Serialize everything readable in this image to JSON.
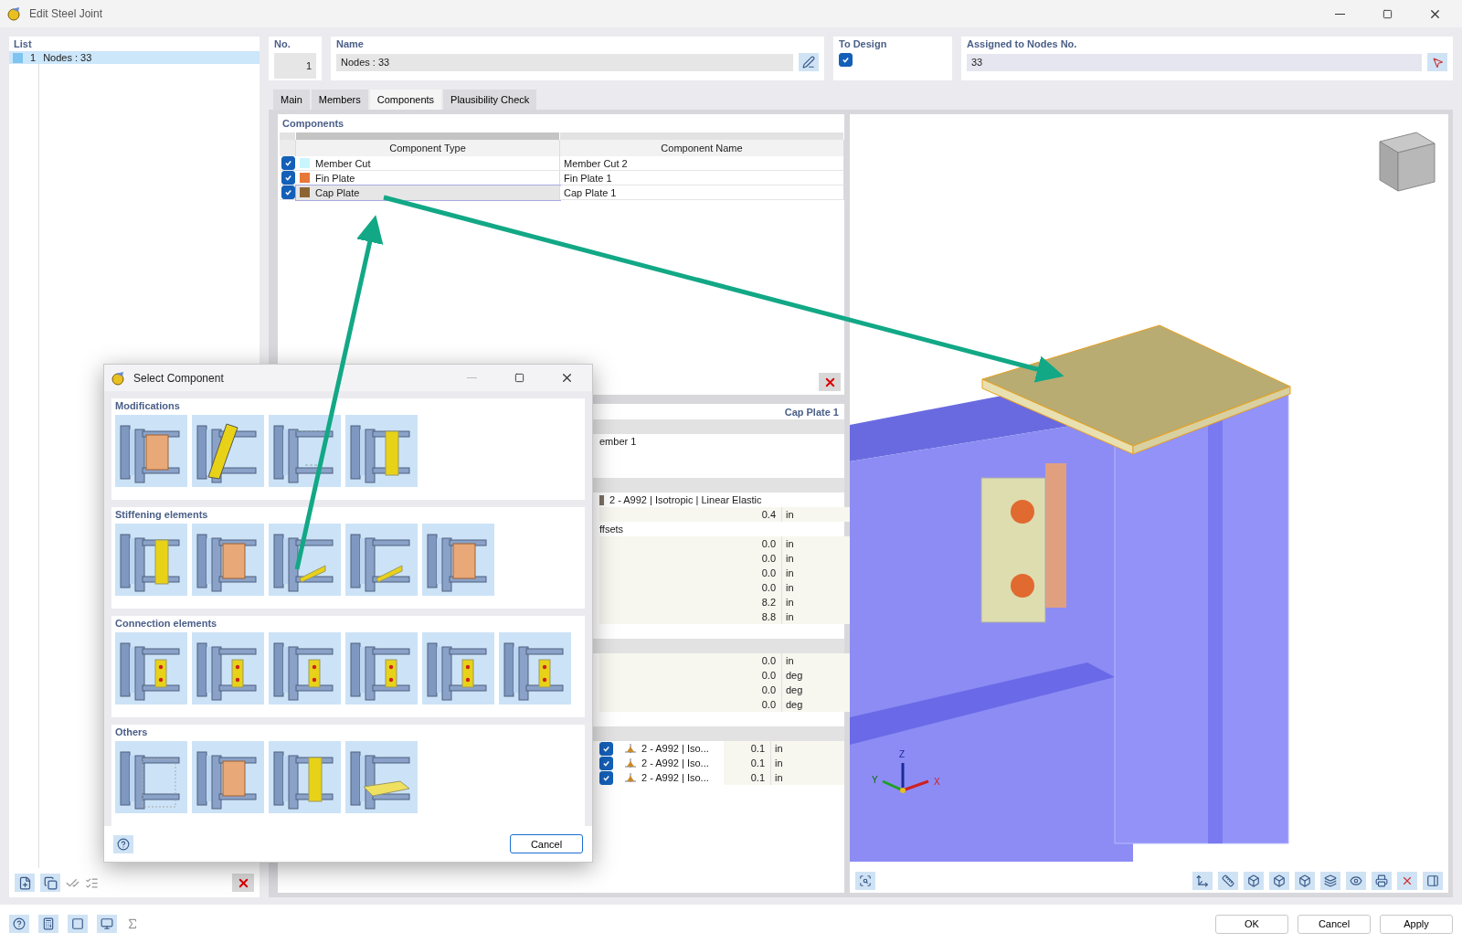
{
  "window": {
    "title": "Edit Steel Joint"
  },
  "list": {
    "title": "List",
    "items": [
      {
        "number": "1",
        "label": "Nodes : 33",
        "selected": true
      }
    ]
  },
  "header_fields": {
    "no": {
      "label": "No.",
      "value": "1"
    },
    "name": {
      "label": "Name",
      "value": "Nodes : 33"
    },
    "to_design": {
      "label": "To Design",
      "checked": true
    },
    "assigned_nodes": {
      "label": "Assigned to Nodes No.",
      "value": "33"
    }
  },
  "tabs": [
    {
      "label": "Main",
      "selected": false
    },
    {
      "label": "Members",
      "selected": false
    },
    {
      "label": "Components",
      "selected": true
    },
    {
      "label": "Plausibility Check",
      "selected": false
    }
  ],
  "components": {
    "title": "Components",
    "columns": [
      "Component Type",
      "Component Name"
    ],
    "rows": [
      {
        "checked": true,
        "color": "#c8f6fc",
        "type": "Member Cut",
        "name": "Member Cut 2",
        "selected": false
      },
      {
        "checked": true,
        "color": "#e8783a",
        "type": "Fin Plate",
        "name": "Fin Plate 1",
        "selected": false
      },
      {
        "checked": true,
        "color": "#8c6434",
        "type": "Cap Plate",
        "name": "Cap Plate 1",
        "selected": true
      }
    ]
  },
  "properties": {
    "title": "Cap Plate 1",
    "rows": [
      {
        "kind": "section"
      },
      {
        "kind": "text",
        "text": "ember 1"
      },
      {
        "kind": "blank"
      },
      {
        "kind": "blank"
      },
      {
        "kind": "section"
      },
      {
        "kind": "material",
        "color": "#7d6e60",
        "text": "2 - A992 | Isotropic | Linear Elastic"
      },
      {
        "kind": "value",
        "value": "0.4",
        "unit": "in"
      },
      {
        "kind": "text",
        "text": "ffsets"
      },
      {
        "kind": "value",
        "value": "0.0",
        "unit": "in"
      },
      {
        "kind": "value",
        "value": "0.0",
        "unit": "in"
      },
      {
        "kind": "value",
        "value": "0.0",
        "unit": "in"
      },
      {
        "kind": "value",
        "value": "0.0",
        "unit": "in"
      },
      {
        "kind": "value",
        "value": "8.2",
        "unit": "in"
      },
      {
        "kind": "value",
        "value": "8.8",
        "unit": "in"
      },
      {
        "kind": "blank"
      },
      {
        "kind": "section"
      },
      {
        "kind": "value",
        "value": "0.0",
        "unit": "in"
      },
      {
        "kind": "value",
        "value": "0.0",
        "unit": "deg"
      },
      {
        "kind": "value",
        "value": "0.0",
        "unit": "deg"
      },
      {
        "kind": "value",
        "value": "0.0",
        "unit": "deg"
      },
      {
        "kind": "blank"
      },
      {
        "kind": "section"
      },
      {
        "kind": "weld",
        "checked": true,
        "material": "2 - A992 | Iso...",
        "value": "0.1",
        "unit": "in"
      },
      {
        "kind": "weld",
        "checked": true,
        "material": "2 - A992 | Iso...",
        "value": "0.1",
        "unit": "in"
      },
      {
        "kind": "weld",
        "checked": true,
        "material": "2 - A992 | Iso...",
        "value": "0.1",
        "unit": "in"
      }
    ]
  },
  "view_axes": {
    "z": "Z",
    "y": "Y",
    "x": "X"
  },
  "dialog": {
    "title": "Select Component",
    "groups": [
      {
        "title": "Modifications"
      },
      {
        "title": "Stiffening elements"
      },
      {
        "title": "Connection elements"
      },
      {
        "title": "Others"
      }
    ],
    "cancel": "Cancel"
  },
  "footer_buttons": [
    "OK",
    "Cancel",
    "Apply"
  ]
}
